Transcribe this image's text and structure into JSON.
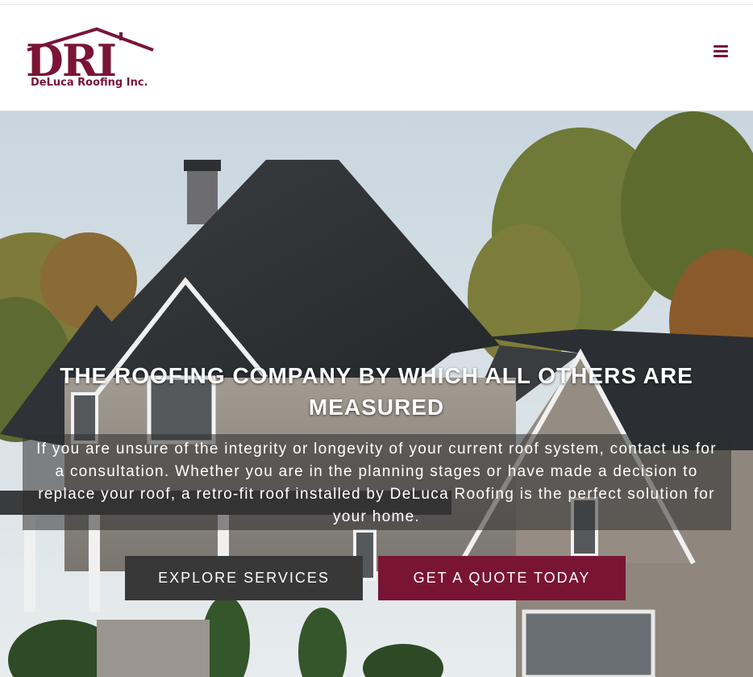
{
  "header": {
    "logo": {
      "letters": "DRI",
      "company_name": "DeLuca Roofing Inc."
    },
    "menu_icon": "hamburger-menu-icon"
  },
  "hero": {
    "title": "THE ROOFING COMPANY BY WHICH ALL OTHERS ARE MEASURED",
    "text": "If you are unsure of the integrity or longevity of your current roof system, contact us for a consultation. Whether you are in the planning stages or have made a decision to replace your roof, a retro-fit roof installed by DeLuca Roofing is the perfect solution for your home.",
    "buttons": {
      "explore_label": "EXPLORE SERVICES",
      "quote_label": "GET A QUOTE TODAY"
    }
  },
  "colors": {
    "brand": "#7a1435",
    "dark_button": "#383838",
    "text_on_dark": "#ffffff"
  }
}
